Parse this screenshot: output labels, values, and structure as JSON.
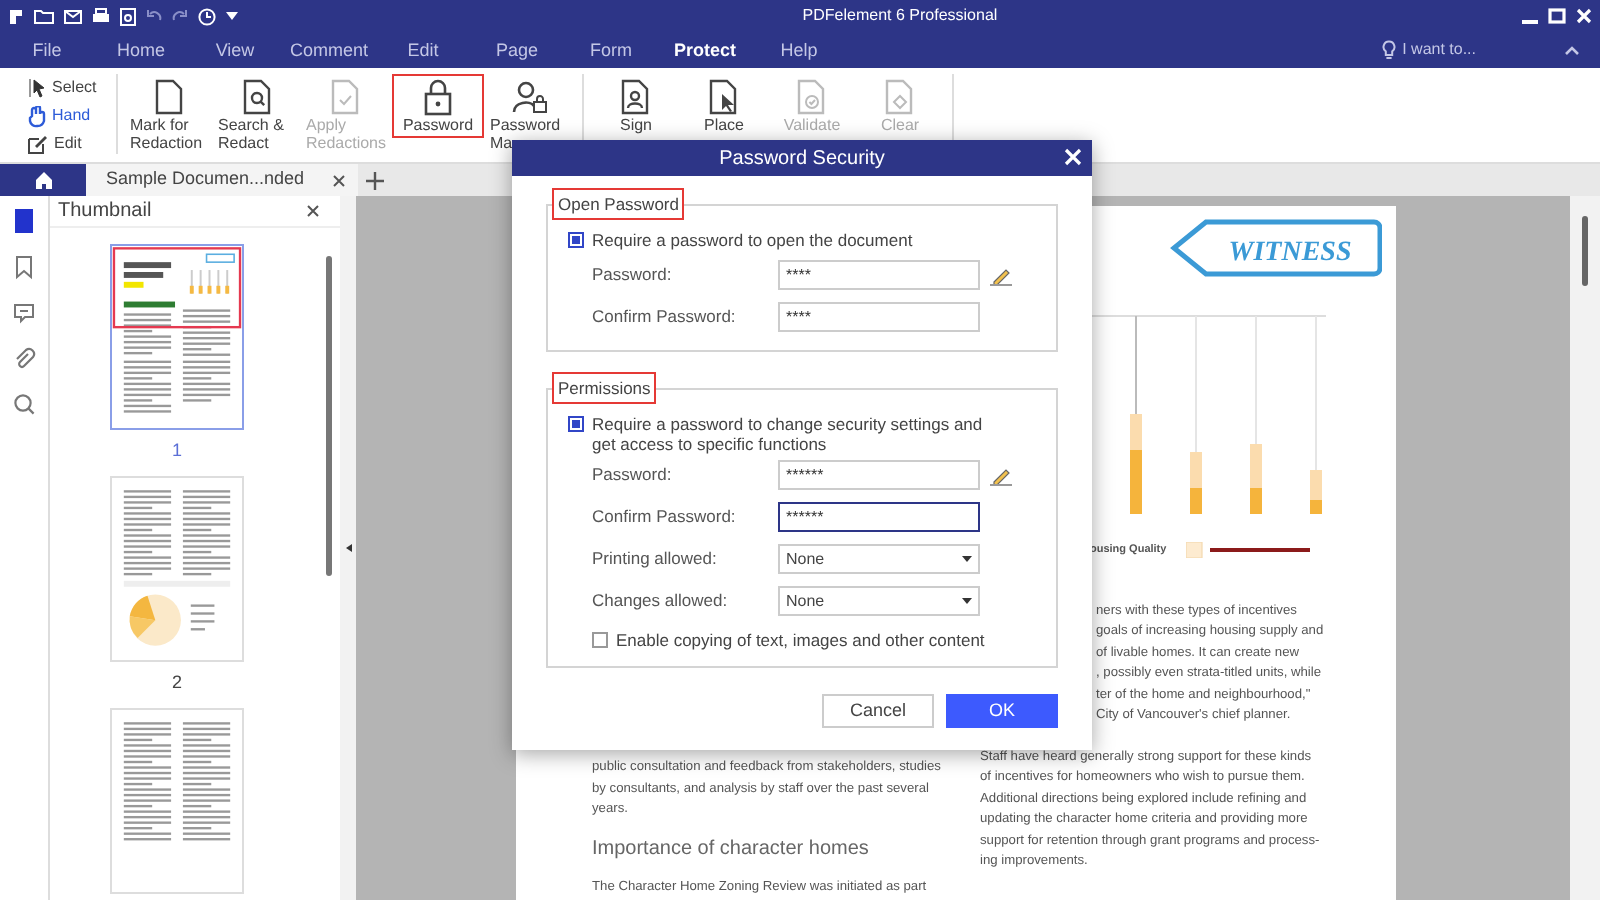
{
  "window": {
    "title": "PDFelement 6 Professional"
  },
  "menu": [
    {
      "label": "File",
      "selected": false
    },
    {
      "label": "Home",
      "selected": false
    },
    {
      "label": "View",
      "selected": false
    },
    {
      "label": "Comment",
      "selected": false
    },
    {
      "label": "Edit",
      "selected": false
    },
    {
      "label": "Page",
      "selected": false
    },
    {
      "label": "Form",
      "selected": false
    },
    {
      "label": "Protect",
      "selected": true
    },
    {
      "label": "Help",
      "selected": false
    }
  ],
  "help_search": {
    "label": "I want to..."
  },
  "ribbon": {
    "tools": [
      {
        "label": "Select",
        "kind": "select",
        "selected": false
      },
      {
        "label": "Hand",
        "kind": "hand",
        "selected": true
      },
      {
        "label": "Edit",
        "kind": "edit",
        "selected": false
      }
    ],
    "groups": [
      [
        {
          "label": "Mark for Redaction",
          "kind": "doc",
          "disabled": false,
          "highlighted": false
        },
        {
          "label": "Search & Redact",
          "kind": "search-doc",
          "disabled": false,
          "highlighted": false
        },
        {
          "label": "Apply Redactions",
          "kind": "check-doc",
          "disabled": true,
          "highlighted": false
        },
        {
          "label": "Password",
          "kind": "lock",
          "disabled": false,
          "highlighted": true
        },
        {
          "label": "Password Ma",
          "kind": "user-lock",
          "disabled": false,
          "highlighted": false
        }
      ],
      [
        {
          "label": "Sign",
          "kind": "sign",
          "disabled": false,
          "highlighted": false
        },
        {
          "label": "Place",
          "kind": "place",
          "disabled": false,
          "highlighted": false
        },
        {
          "label": "Validate",
          "kind": "validate",
          "disabled": true,
          "highlighted": false
        },
        {
          "label": "Clear",
          "kind": "clear",
          "disabled": true,
          "highlighted": false
        }
      ]
    ]
  },
  "tabs": [
    {
      "label": "Sample Documen...nded",
      "selected": true
    }
  ],
  "side_rail": [
    {
      "kind": "pages",
      "selected": true
    },
    {
      "kind": "bookmarks",
      "selected": false
    },
    {
      "kind": "comments",
      "selected": false
    },
    {
      "kind": "attachments",
      "selected": false
    },
    {
      "kind": "search",
      "selected": false
    }
  ],
  "thumbnail_panel": {
    "title": "Thumbnail",
    "pages": [
      {
        "number": "1",
        "kind": "chart",
        "selected": true,
        "in_view": true
      },
      {
        "number": "2",
        "kind": "pie",
        "selected": false,
        "in_view": false
      },
      {
        "kind": "text",
        "selected": false,
        "in_view": false
      }
    ]
  },
  "document": {
    "stamp": "WITNESS",
    "legend": "ousing Quality",
    "right_paragraphs": [
      {
        "lines": [
          "ners with these types of incentives",
          "goals of increasing housing supply and",
          "of livable homes.  It can create new",
          ", possibly even strata-titled units, while",
          "ter of the home and neighbourhood,\"",
          "City of Vancouver's chief planner."
        ]
      },
      {
        "lines": [
          "Staff have heard generally strong support for these kinds",
          "of incentives for homeowners who wish to pursue them.",
          "Additional directions being explored include refining and",
          "updating the character home criteria and providing more",
          "support for retention through grant programs and process-",
          "ing improvements."
        ]
      }
    ],
    "left_paragraph": {
      "lines": [
        "public consultation and feedback from stakeholders, studies",
        "by consultants, and analysis by staff over the past several",
        "years."
      ]
    },
    "heading": "Importance of character homes",
    "last_line": "The Character Home Zoning Review was initiated as part"
  },
  "dialog": {
    "title": "Password Security",
    "groups": [
      {
        "legend": "Open Password",
        "highlighted": true,
        "require": {
          "label": "Require a password to open the document",
          "checked": true
        },
        "fields": [
          {
            "label": "Password:",
            "kind": "password",
            "value": "****",
            "edit_icon": true,
            "focused": false
          },
          {
            "label": "Confirm Password:",
            "kind": "password",
            "value": "****",
            "edit_icon": false,
            "focused": false
          }
        ]
      },
      {
        "legend": "Permissions",
        "highlighted": true,
        "require": {
          "label": "Require a password to change security settings and get access to specific functions",
          "checked": true
        },
        "fields": [
          {
            "label": "Password:",
            "kind": "password",
            "value": "******",
            "edit_icon": true,
            "focused": false
          },
          {
            "label": "Confirm Password:",
            "kind": "password",
            "value": "******",
            "edit_icon": false,
            "focused": true
          },
          {
            "label": "Printing allowed:",
            "kind": "select",
            "value": "None"
          },
          {
            "label": "Changes allowed:",
            "kind": "select",
            "value": "None"
          }
        ],
        "copy": {
          "label": "Enable copying of text, images and other content",
          "checked": false
        }
      }
    ],
    "buttons": [
      {
        "label": "Cancel",
        "primary": false
      },
      {
        "label": "OK",
        "primary": true
      }
    ]
  }
}
